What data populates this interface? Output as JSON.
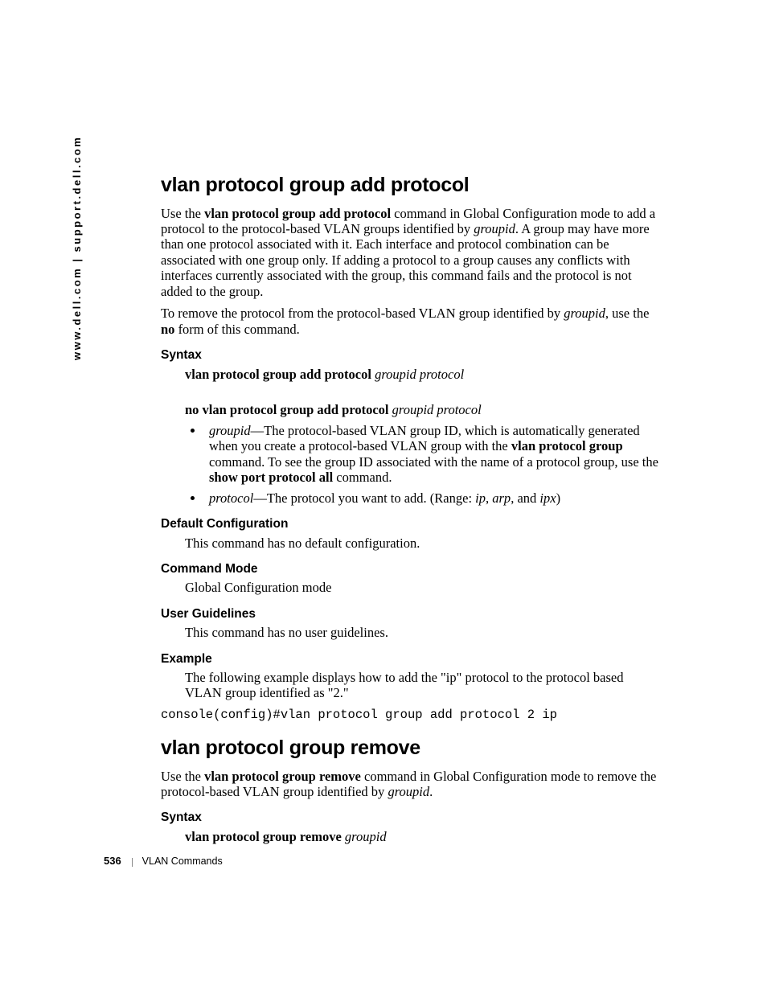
{
  "side": "www.dell.com | support.dell.com",
  "footer": {
    "page": "536",
    "section": "VLAN Commands"
  },
  "s1": {
    "title": "vlan protocol group add protocol",
    "p1_a": "Use the ",
    "p1_b": "vlan protocol group add protocol",
    "p1_c": " command in Global Configuration mode to add a protocol to the protocol-based VLAN groups identified by ",
    "p1_d": "groupid",
    "p1_e": ". A group may have more than one protocol associated with it. Each interface and protocol combination can be associated with one group only. If adding a protocol to a group causes any conflicts with interfaces currently associated with the group, this command fails and the protocol is not added to the group.",
    "p2_a": "To remove the protocol from the protocol-based VLAN group identified by ",
    "p2_b": "groupid",
    "p2_c": ", use the ",
    "p2_d": "no",
    "p2_e": " form of this command.",
    "syntax_h": "Syntax",
    "syn1_b": "vlan protocol group add protocol ",
    "syn1_i": "groupid protocol",
    "syn2_b": "no vlan protocol group add protocol ",
    "syn2_i": "groupid protocol",
    "b1_a": "groupid",
    "b1_b": "—The protocol-based VLAN group ID, which is automatically generated when you create a protocol-based VLAN group with the ",
    "b1_c": "vlan protocol group",
    "b1_d": " command. To see the group ID associated with the name of a protocol group, use the ",
    "b1_e": "show port protocol all",
    "b1_f": " command.",
    "b2_a": "protocol",
    "b2_b": "—The protocol you want to add. (Range: ",
    "b2_c": "ip",
    "b2_d": ", ",
    "b2_e": "arp",
    "b2_f": ", and ",
    "b2_g": "ipx",
    "b2_h": ")",
    "def_h": "Default Configuration",
    "def_t": "This command has no default configuration.",
    "mode_h": "Command Mode",
    "mode_t": "Global Configuration mode",
    "ug_h": "User Guidelines",
    "ug_t": "This command has no user guidelines.",
    "ex_h": "Example",
    "ex_t": "The following example displays how to add the \"ip\" protocol to the protocol based VLAN group identified as \"2.\"",
    "ex_code": "console(config)#vlan protocol group add protocol 2 ip"
  },
  "s2": {
    "title": "vlan protocol group remove",
    "p1_a": "Use the ",
    "p1_b": "vlan protocol group remove",
    "p1_c": " command in Global Configuration mode to remove the protocol-based VLAN group identified by ",
    "p1_d": "groupid",
    "p1_e": ".",
    "syntax_h": "Syntax",
    "syn1_b": "vlan protocol group remove ",
    "syn1_i": "groupid"
  }
}
